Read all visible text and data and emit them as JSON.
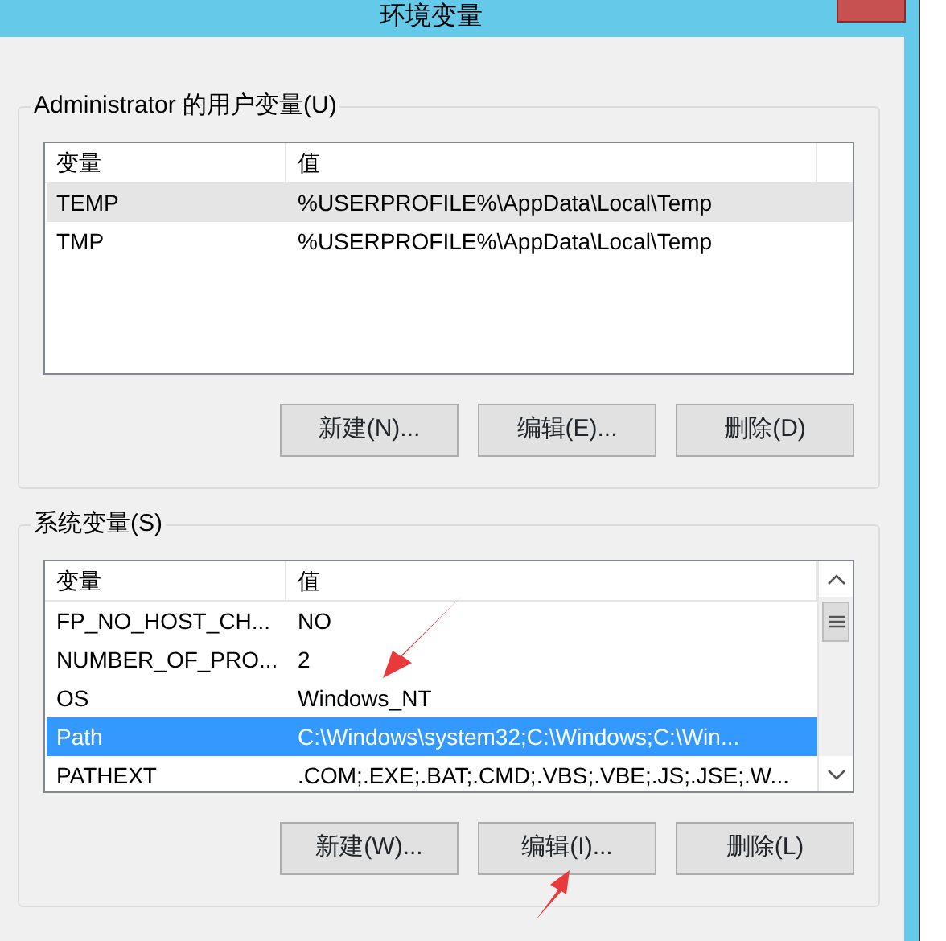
{
  "window": {
    "title": "环境变量"
  },
  "user_vars": {
    "legend": "Administrator 的用户变量(U)",
    "focused": false,
    "scrollbar": false,
    "columns": [
      "变量",
      "值"
    ],
    "rows": [
      {
        "name": "TEMP",
        "value": "%USERPROFILE%\\AppData\\Local\\Temp",
        "selected": true
      },
      {
        "name": "TMP",
        "value": "%USERPROFILE%\\AppData\\Local\\Temp",
        "selected": false
      }
    ],
    "buttons": [
      "新建(N)...",
      "编辑(E)...",
      "删除(D)"
    ]
  },
  "system_vars": {
    "legend": "系统变量(S)",
    "focused": true,
    "scrollbar": true,
    "columns": [
      "变量",
      "值"
    ],
    "rows": [
      {
        "name": "FP_NO_HOST_CH...",
        "value": "NO",
        "selected": false
      },
      {
        "name": "NUMBER_OF_PRO...",
        "value": "2",
        "selected": false
      },
      {
        "name": "OS",
        "value": "Windows_NT",
        "selected": false
      },
      {
        "name": "Path",
        "value": "C:\\Windows\\system32;C:\\Windows;C:\\Win...",
        "selected": true
      },
      {
        "name": "PATHEXT",
        "value": ".COM;.EXE;.BAT;.CMD;.VBS;.VBE;.JS;.JSE;.W...",
        "selected": false
      }
    ],
    "buttons": [
      "新建(W)...",
      "编辑(I)...",
      "删除(L)"
    ]
  }
}
